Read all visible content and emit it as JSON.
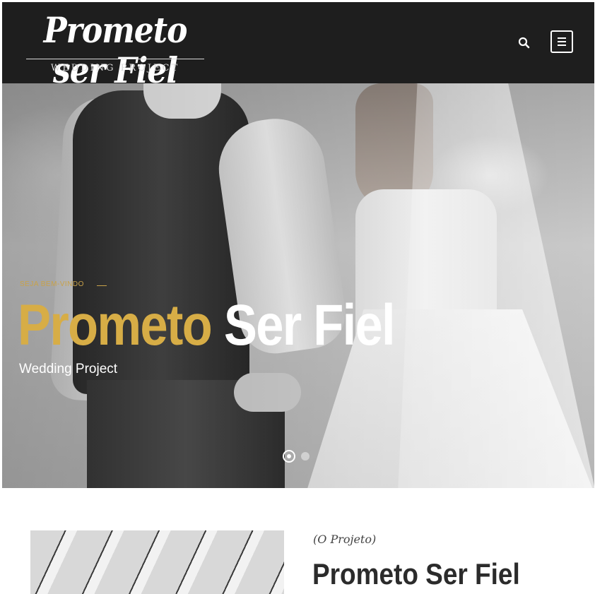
{
  "header": {
    "logo_script": "Prometo ser Fiel",
    "logo_sub": "WEDDING PROJECT",
    "search_icon": "search-icon",
    "menu_icon": "hamburger-menu-icon"
  },
  "hero": {
    "kicker": "SEJA BEM-VINDO",
    "title_part1": "Prometo",
    "title_part2": "Ser Fiel",
    "subtitle": "Wedding Project",
    "accent_color": "#d7ad46",
    "slides_total": 2,
    "active_slide": 1
  },
  "section": {
    "kicker": "(O Projeto)",
    "title": "Prometo Ser Fiel"
  }
}
